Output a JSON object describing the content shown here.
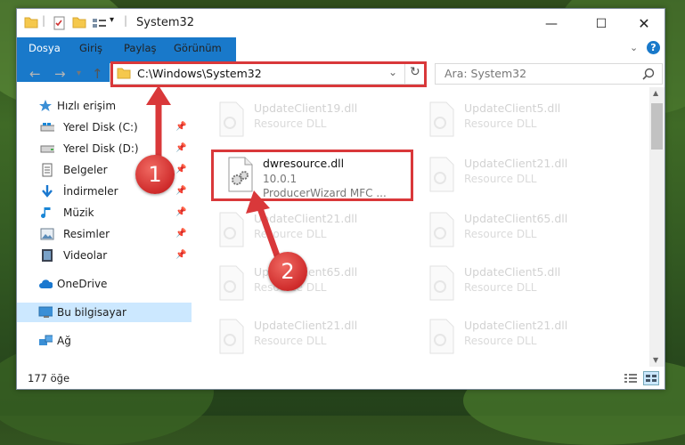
{
  "window": {
    "title": "System32"
  },
  "ribbon": {
    "tabs": [
      "Dosya",
      "Giriş",
      "Paylaş",
      "Görünüm"
    ]
  },
  "address": {
    "path": "C:\\Windows\\System32",
    "search_placeholder": "Ara: System32"
  },
  "sidebar": {
    "items": [
      {
        "label": "Hızlı erişim",
        "icon": "star-icon",
        "pinned": false
      },
      {
        "label": "Yerel Disk (C:)",
        "icon": "drive-icon",
        "pinned": true
      },
      {
        "label": "Yerel Disk (D:)",
        "icon": "drive-icon",
        "pinned": true
      },
      {
        "label": "Belgeler",
        "icon": "documents-icon",
        "pinned": true
      },
      {
        "label": "İndirmeler",
        "icon": "download-icon",
        "pinned": true
      },
      {
        "label": "Müzik",
        "icon": "music-icon",
        "pinned": true
      },
      {
        "label": "Resimler",
        "icon": "pictures-icon",
        "pinned": true
      },
      {
        "label": "Videolar",
        "icon": "videos-icon",
        "pinned": true
      },
      {
        "label": "OneDrive",
        "icon": "cloud-icon",
        "pinned": false
      },
      {
        "label": "Bu bilgisayar",
        "icon": "computer-icon",
        "pinned": false,
        "selected": true
      },
      {
        "label": "Ağ",
        "icon": "network-icon",
        "pinned": false
      }
    ]
  },
  "files": {
    "col1": [
      {
        "name": "UpdateClient19.dll",
        "desc": "Resource DLL"
      },
      {
        "name": "dwresource.dll",
        "version": "10.0.1",
        "desc": "ProducerWizard MFC ...",
        "highlighted": true
      },
      {
        "name": "UpdateClient21.dll",
        "desc": "Resource DLL"
      },
      {
        "name": "UpdateClient65.dll",
        "desc": "Resource DLL"
      },
      {
        "name": "UpdateClient21.dll",
        "desc": "Resource DLL"
      }
    ],
    "col2": [
      {
        "name": "UpdateClient5.dll",
        "desc": "Resource DLL"
      },
      {
        "name": "UpdateClient21.dll",
        "desc": "Resource DLL"
      },
      {
        "name": "UpdateClient65.dll",
        "desc": "Resource DLL"
      },
      {
        "name": "UpdateClient5.dll",
        "desc": "Resource DLL"
      },
      {
        "name": "UpdateClient21.dll",
        "desc": "Resource DLL"
      }
    ]
  },
  "status": {
    "count": "177 öğe"
  },
  "annotations": {
    "step1": "1",
    "step2": "2"
  },
  "colors": {
    "accent": "#1979ca",
    "highlight": "#d9383a",
    "selection": "#cce8ff"
  }
}
